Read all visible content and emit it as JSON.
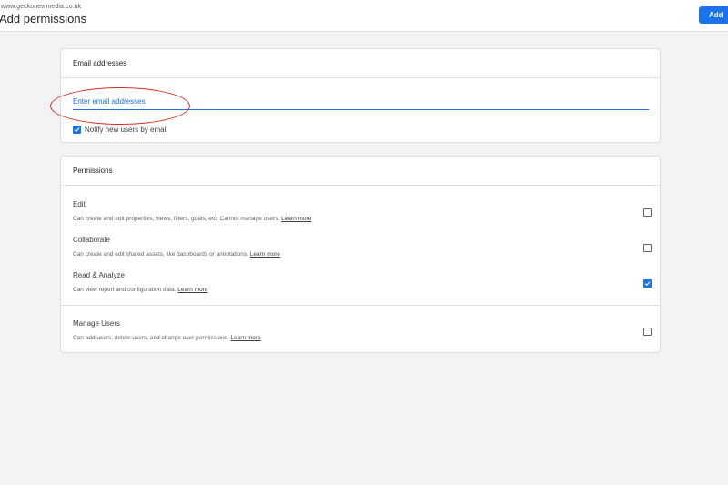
{
  "header": {
    "account_url": "www.geckonewmedia.co.uk",
    "title": "Add permissions",
    "add_button_label": "Add"
  },
  "email_section": {
    "heading": "Email addresses",
    "input_placeholder": "Enter email addresses",
    "input_value": "",
    "notify_label": "Notify new users by email",
    "notify_checked": true
  },
  "permissions_section": {
    "heading": "Permissions",
    "link_label": "Learn more",
    "items": [
      {
        "title": "Edit",
        "description": "Can create and edit properties, views, filters, goals, etc. Cannot manage users.",
        "checked": false
      },
      {
        "title": "Collaborate",
        "description": "Can create and edit shared assets, like dashboards or annotations.",
        "checked": false
      },
      {
        "title": "Read & Analyze",
        "description": "Can view report and configuration data.",
        "checked": true
      },
      {
        "title": "Manage Users",
        "description": "Can add users, delete users, and change user permissions.",
        "checked": false
      }
    ]
  },
  "colors": {
    "accent": "#1a73e8",
    "highlight_circle": "#d93025",
    "background": "#f1f3f4"
  }
}
